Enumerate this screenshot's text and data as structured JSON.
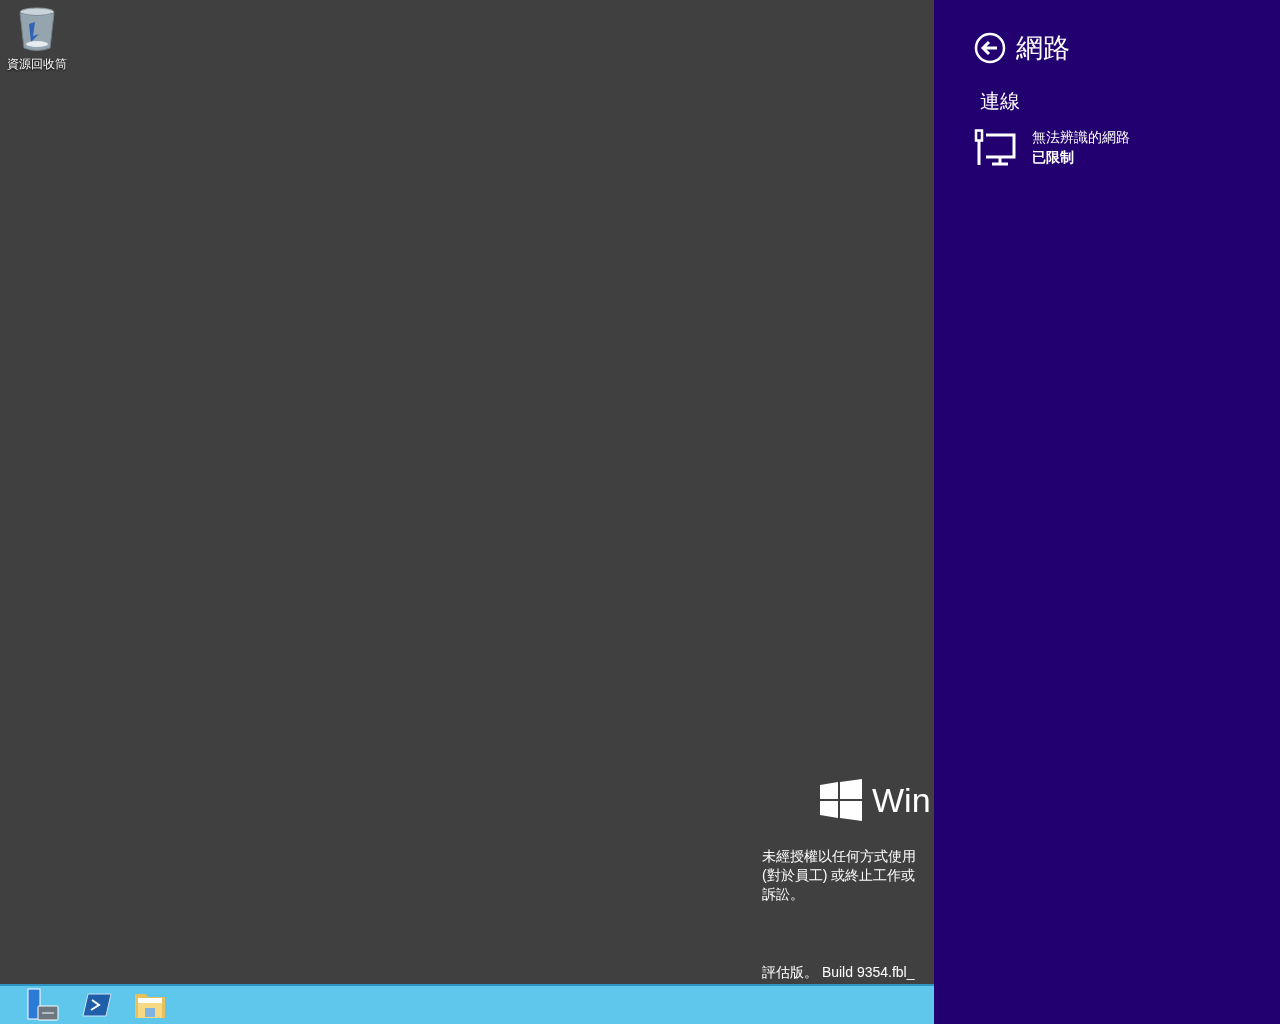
{
  "desktop_icons": [
    {
      "label": "資源回收筒"
    }
  ],
  "watermark": {
    "brand": "Win",
    "notice_lines": [
      "未經授權以任何方式使用",
      "(對於員工) 或終止工作或",
      "訴訟。"
    ],
    "build": "評估版。 Build 9354.fbl_"
  },
  "panel": {
    "title": "網路",
    "section": "連線",
    "networks": [
      {
        "name": "無法辨識的網路",
        "status": "已限制"
      }
    ]
  }
}
